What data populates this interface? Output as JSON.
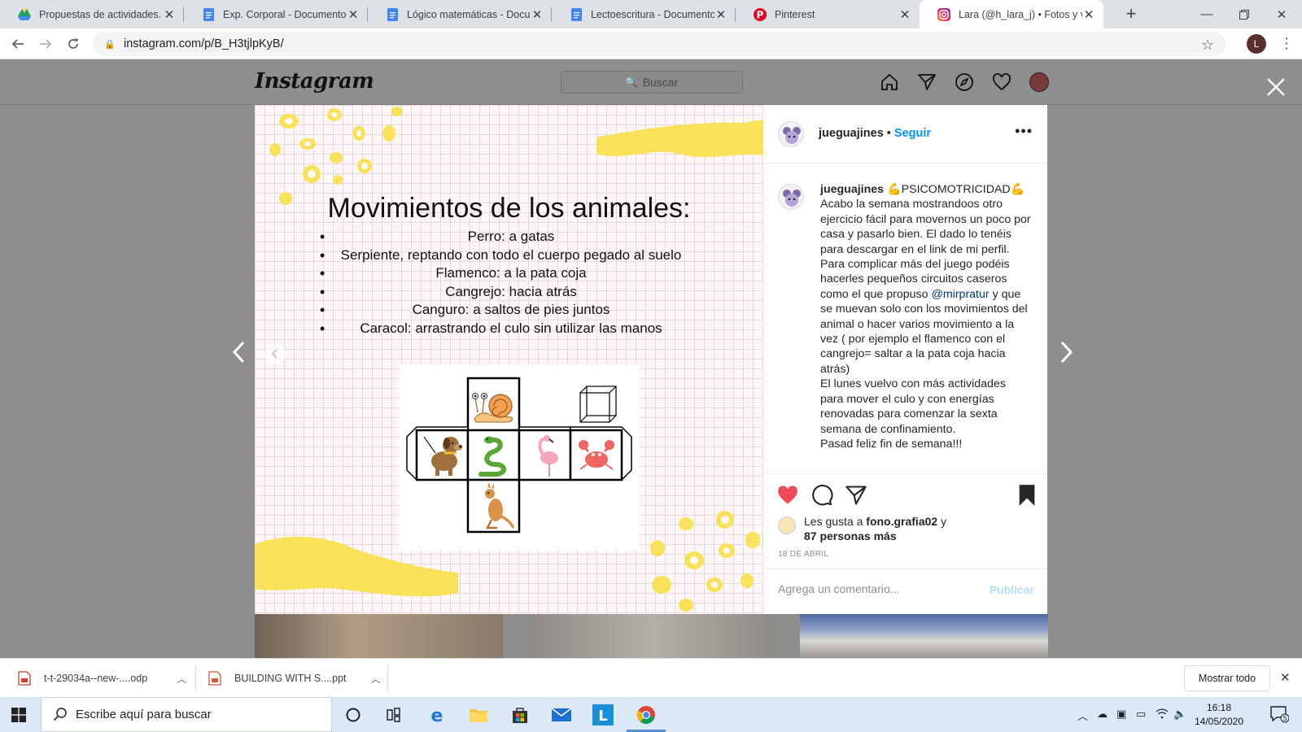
{
  "browser": {
    "tabs": [
      {
        "title": "Propuestas de actividades. Bl",
        "icon": "google-drive-icon"
      },
      {
        "title": "Exp. Corporal - Documentos d",
        "icon": "google-docs-icon"
      },
      {
        "title": "Lógico matemáticas - Docum",
        "icon": "google-docs-icon"
      },
      {
        "title": "Lectoescritura - Documentos",
        "icon": "google-docs-icon"
      },
      {
        "title": "Pinterest",
        "icon": "pinterest-icon"
      },
      {
        "title": "Lara (@h_lara_j) • Fotos y vid",
        "icon": "instagram-icon"
      }
    ],
    "url": "instagram.com/p/B_H3tjlpKyB/",
    "profile_initial": "L"
  },
  "instagram": {
    "logo": "Instagram",
    "search_placeholder": "Buscar",
    "post": {
      "title": "Movimientos de los animales:",
      "items": [
        "Perro: a gatas",
        "Serpiente, reptando con todo el cuerpo pegado al suelo",
        "Flamenco: a la pata coja",
        "Cangrejo: hacia atrás",
        "Canguro: a saltos de pies juntos",
        "Caracol: arrastrando el culo sin utilizar las manos"
      ]
    },
    "author": {
      "username": "jueguajines",
      "separator": " • ",
      "follow_label": "Seguir"
    },
    "caption": {
      "username": "jueguajines",
      "headline": "💪PSICOMOTRICIDAD💪",
      "p1": "Acabo la semana mostrandoos otro ejercicio fácil para movernos un poco por casa y pasarlo bien. El dado lo tenéis para descargar en el link de mi perfil.",
      "p2_before": "Para complicar más del juego podéis hacerles pequeños circuitos caseros como el que propuso ",
      "mention": "@mirpratur",
      "p2_after": " y que se muevan solo con los movimientos del animal o hacer varios movimiento a la vez ( por ejemplo el flamenco con el cangrejo= saltar a la pata coja hacia atrás)",
      "p3": "El lunes vuelvo con más actividades para mover el culo y con energías renovadas para comenzar la sexta semana de confinamiento.",
      "p4": "Pasad feliz fin de semana!!!"
    },
    "likes": {
      "prefix": "Les gusta a ",
      "user": "fono.grafia02",
      "connector": " y",
      "others": "87 personas más"
    },
    "date": "18 DE ABRIL",
    "comment_placeholder": "Agrega un comentario...",
    "publish_label": "Publicar",
    "colors": {
      "like": "#ed4956",
      "link": "#0095f6",
      "publish_disabled": "#b2dffc",
      "accent_yellow": "#f9e25a"
    }
  },
  "downloads": {
    "items": [
      {
        "name": "t-t-29034a--new-....odp"
      },
      {
        "name": "BUILDING WITH S....ppt"
      }
    ],
    "show_all": "Mostrar todo"
  },
  "taskbar": {
    "search_placeholder": "Escribe aquí para buscar",
    "time": "16:18",
    "date": "14/05/2020",
    "notifications": "5"
  }
}
